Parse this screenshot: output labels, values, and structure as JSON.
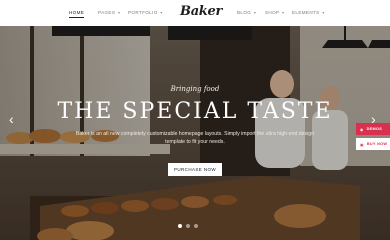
{
  "header": {
    "logo": "Baker",
    "nav_left": [
      {
        "label": "HOME",
        "active": true
      },
      {
        "label": "PAGES",
        "active": false
      },
      {
        "label": "PORTFOLIO",
        "active": false
      }
    ],
    "nav_right": [
      {
        "label": "BLOG",
        "active": false
      },
      {
        "label": "SHOP",
        "active": false
      },
      {
        "label": "ELEMENTS",
        "active": false
      }
    ]
  },
  "hero": {
    "kicker": "Bringing food",
    "headline": "THE SPECIAL TASTE",
    "subline": "Baker is an all new completely customizable homepage layouts. Simply import the ultra high-end design template to fit your needs.",
    "cta_label": "PURCHASE NOW",
    "slide_count": 3,
    "active_slide": 1
  },
  "side_widgets": {
    "a": "DEMOS",
    "b": "BUY NOW"
  },
  "colors": {
    "accent": "#d9304f",
    "text_dark": "#222222"
  }
}
